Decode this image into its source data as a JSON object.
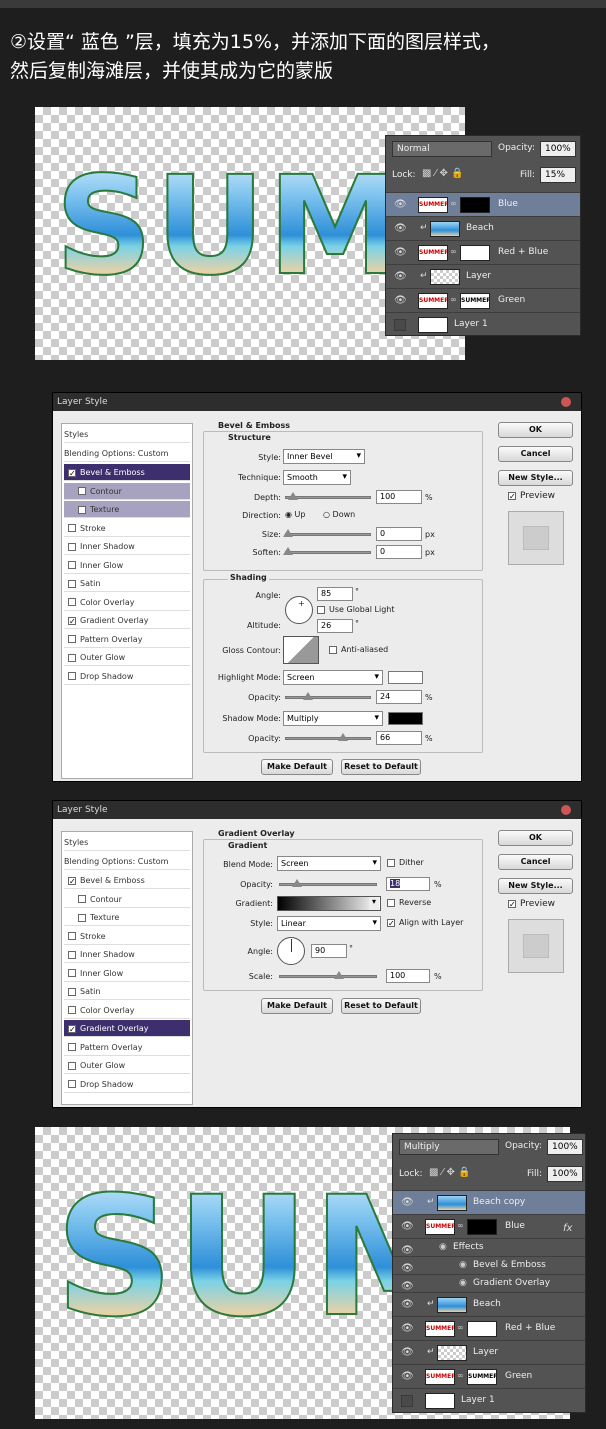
{
  "title": {
    "line1": "②设置“ 蓝色 ”层，填充为15%，并添加下面的图层样式，",
    "line2": "然后复制海滩层，并使其成为它的蒙版"
  },
  "canvas_text": "SUMMER",
  "panel1": {
    "blend": "Normal",
    "opacity_label": "Opacity:",
    "opacity": "100%",
    "lock_label": "Lock:",
    "fill_label": "Fill:",
    "fill": "15%",
    "layers": [
      {
        "name": "Blue",
        "selected": true,
        "thumb": "SUMMER",
        "mask": "black"
      },
      {
        "name": "Beach",
        "clip": true
      },
      {
        "name": "Red + Blue",
        "thumb": "SUMMER",
        "mask": "white"
      },
      {
        "name": "Layer",
        "clip": true
      },
      {
        "name": "Green",
        "thumb": "SUMMER",
        "mask": "SUMMER"
      },
      {
        "name": "Layer 1",
        "hidden": true
      }
    ]
  },
  "dialog1": {
    "title": "Layer Style",
    "styles_header": "Styles",
    "blending": "Blending Options: Custom",
    "items": [
      {
        "label": "Bevel & Emboss",
        "checked": true,
        "selected": true
      },
      {
        "label": "Contour",
        "sub": true
      },
      {
        "label": "Texture",
        "sub": true
      },
      {
        "label": "Stroke"
      },
      {
        "label": "Inner Shadow"
      },
      {
        "label": "Inner Glow"
      },
      {
        "label": "Satin"
      },
      {
        "label": "Color Overlay"
      },
      {
        "label": "Gradient Overlay",
        "checked": true
      },
      {
        "label": "Pattern Overlay"
      },
      {
        "label": "Outer Glow"
      },
      {
        "label": "Drop Shadow"
      }
    ],
    "section": "Bevel & Emboss",
    "structure": "Structure",
    "style_label": "Style:",
    "style": "Inner Bevel",
    "technique_label": "Technique:",
    "technique": "Smooth",
    "depth_label": "Depth:",
    "depth": "100",
    "direction_label": "Direction:",
    "up": "Up",
    "down": "Down",
    "size_label": "Size:",
    "size": "0",
    "soften_label": "Soften:",
    "soften": "0",
    "px": "px",
    "pct": "%",
    "shading": "Shading",
    "angle_label": "Angle:",
    "angle": "85",
    "global_light": "Use Global Light",
    "altitude_label": "Altitude:",
    "altitude": "26",
    "gloss_label": "Gloss Contour:",
    "anti": "Anti-aliased",
    "hmode_label": "Highlight Mode:",
    "hmode": "Screen",
    "opacity_label": "Opacity:",
    "hopacity": "24",
    "smode_label": "Shadow Mode:",
    "smode": "Multiply",
    "sopacity": "66",
    "deg": "°",
    "make_default": "Make Default",
    "reset": "Reset to Default",
    "ok": "OK",
    "cancel": "Cancel",
    "new_style": "New Style...",
    "preview": "Preview"
  },
  "dialog2": {
    "title": "Layer Style",
    "styles_header": "Styles",
    "blending": "Blending Options: Custom",
    "items": [
      {
        "label": "Bevel & Emboss",
        "checked": true
      },
      {
        "label": "Contour",
        "sub2": true
      },
      {
        "label": "Texture",
        "sub2": true
      },
      {
        "label": "Stroke"
      },
      {
        "label": "Inner Shadow"
      },
      {
        "label": "Inner Glow"
      },
      {
        "label": "Satin"
      },
      {
        "label": "Color Overlay"
      },
      {
        "label": "Gradient Overlay",
        "checked": true,
        "selected": true
      },
      {
        "label": "Pattern Overlay"
      },
      {
        "label": "Outer Glow"
      },
      {
        "label": "Drop Shadow"
      }
    ],
    "section": "Gradient Overlay",
    "sub": "Gradient",
    "blend_label": "Blend Mode:",
    "blend": "Screen",
    "dither": "Dither",
    "opacity_label": "Opacity:",
    "opacity": "18",
    "gradient_label": "Gradient:",
    "reverse": "Reverse",
    "style_label": "Style:",
    "style": "Linear",
    "align": "Align with Layer",
    "angle_label": "Angle:",
    "angle": "90",
    "scale_label": "Scale:",
    "scale": "100",
    "pct": "%",
    "deg": "°",
    "make_default": "Make Default",
    "reset": "Reset to Default",
    "ok": "OK",
    "cancel": "Cancel",
    "new_style": "New Style...",
    "preview": "Preview"
  },
  "panel2": {
    "blend": "Multiply",
    "opacity_label": "Opacity:",
    "opacity": "100%",
    "lock_label": "Lock:",
    "fill_label": "Fill:",
    "fill": "100%",
    "fx": "fx",
    "layers": [
      {
        "name": "Beach copy",
        "clip": true,
        "selected": true
      },
      {
        "name": "Blue",
        "thumb": "SUMMER",
        "mask": "black"
      },
      {
        "name": "Effects",
        "effect": true
      },
      {
        "name": "Bevel & Emboss",
        "effect2": true
      },
      {
        "name": "Gradient Overlay",
        "effect2": true
      },
      {
        "name": "Beach",
        "clip": true
      },
      {
        "name": "Red + Blue",
        "thumb": "SUMMER",
        "mask": "white"
      },
      {
        "name": "Layer",
        "clip": true
      },
      {
        "name": "Green",
        "thumb": "SUMMER",
        "mask": "SUMMER"
      },
      {
        "name": "Layer 1",
        "hidden": true
      }
    ]
  }
}
